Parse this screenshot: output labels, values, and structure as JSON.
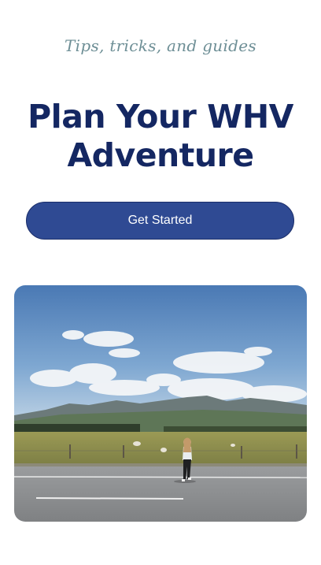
{
  "hero": {
    "tagline": "Tips, tricks, and guides",
    "headline_line1": "Plan Your WHV",
    "headline_line2": "Adventure",
    "cta_label": "Get Started"
  },
  "colors": {
    "tagline": "#6e8f96",
    "headline": "#142762",
    "cta_background": "#2f4a93",
    "cta_text": "#ffffff"
  },
  "image": {
    "subject": "person-walking-on-road-photo"
  }
}
